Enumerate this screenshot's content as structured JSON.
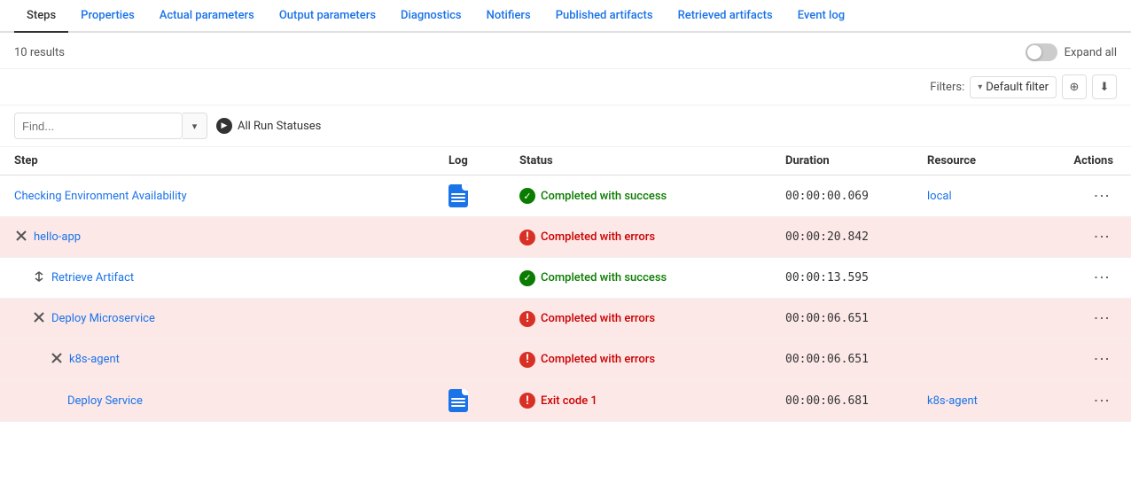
{
  "tabs": [
    {
      "id": "steps",
      "label": "Steps",
      "active": true
    },
    {
      "id": "properties",
      "label": "Properties",
      "active": false
    },
    {
      "id": "actual-parameters",
      "label": "Actual parameters",
      "active": false
    },
    {
      "id": "output-parameters",
      "label": "Output parameters",
      "active": false
    },
    {
      "id": "diagnostics",
      "label": "Diagnostics",
      "active": false
    },
    {
      "id": "notifiers",
      "label": "Notifiers",
      "active": false
    },
    {
      "id": "published-artifacts",
      "label": "Published artifacts",
      "active": false
    },
    {
      "id": "retrieved-artifacts",
      "label": "Retrieved artifacts",
      "active": false
    },
    {
      "id": "event-log",
      "label": "Event log",
      "active": false
    }
  ],
  "topbar": {
    "results_count": "10 results",
    "expand_all_label": "Expand all"
  },
  "filters": {
    "label": "Filters:",
    "default_filter": "Default filter",
    "add_filter_title": "Add filter",
    "export_title": "Export"
  },
  "search": {
    "placeholder": "Find...",
    "status_filter_label": "All Run Statuses"
  },
  "table": {
    "columns": {
      "step": "Step",
      "log": "Log",
      "status": "Status",
      "duration": "Duration",
      "resource": "Resource",
      "actions": "Actions"
    },
    "rows": [
      {
        "id": "row-1",
        "step_label": "Checking Environment Availability",
        "indent": 0,
        "has_expand": false,
        "has_log": true,
        "status_type": "success",
        "status_label": "Completed with success",
        "duration": "00:00:00.069",
        "resource": "local",
        "is_error": false
      },
      {
        "id": "row-2",
        "step_label": "hello-app",
        "indent": 0,
        "has_expand": true,
        "expand_icon": "×",
        "has_log": false,
        "status_type": "error",
        "status_label": "Completed with errors",
        "duration": "00:00:20.842",
        "resource": "",
        "is_error": true
      },
      {
        "id": "row-3",
        "step_label": "Retrieve Artifact",
        "indent": 1,
        "has_expand": true,
        "expand_icon": "↕",
        "has_log": false,
        "status_type": "success",
        "status_label": "Completed with success",
        "duration": "00:00:13.595",
        "resource": "",
        "is_error": false
      },
      {
        "id": "row-4",
        "step_label": "Deploy Microservice",
        "indent": 1,
        "has_expand": true,
        "expand_icon": "×",
        "has_log": false,
        "status_type": "error",
        "status_label": "Completed with errors",
        "duration": "00:00:06.651",
        "resource": "",
        "is_error": true
      },
      {
        "id": "row-5",
        "step_label": "k8s-agent",
        "indent": 2,
        "has_expand": true,
        "expand_icon": "×",
        "has_log": false,
        "status_type": "error",
        "status_label": "Completed with errors",
        "duration": "00:00:06.651",
        "resource": "",
        "is_error": true
      },
      {
        "id": "row-6",
        "step_label": "Deploy Service",
        "indent": 3,
        "has_expand": false,
        "has_log": true,
        "status_type": "exit",
        "status_label": "Exit code 1",
        "duration": "00:00:06.681",
        "resource": "k8s-agent",
        "is_error": true
      }
    ]
  },
  "icons": {
    "success_check": "✓",
    "error_exclaim": "!",
    "three_dots": "⋮",
    "chevron_down": "▾",
    "expand_cross": "✕",
    "expand_arrows": "⇅"
  }
}
